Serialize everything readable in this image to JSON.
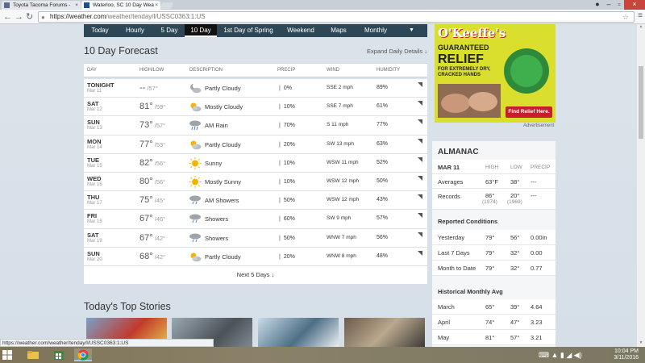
{
  "browser": {
    "tabs": [
      {
        "title": "Toyota Tacoma Forums -",
        "active": false
      },
      {
        "title": "Waterloo, SC 10 Day Wea",
        "active": true
      }
    ],
    "url_host": "https://weather.com",
    "url_path": "/weather/tenday/l/USSC0363:1:US",
    "status_url": "https://weather.com/weather/tenday/l/USSC0363:1:US"
  },
  "subnav": [
    "Today",
    "Hourly",
    "5 Day",
    "10 Day",
    "1st Day of Spring",
    "Weekend",
    "Maps",
    "Monthly"
  ],
  "forecast": {
    "title": "10 Day Forecast",
    "expand_label": "Expand Daily Details ↓",
    "headers": [
      "DAY",
      "HIGH/LOW",
      "DESCRIPTION",
      "PRECIP",
      "WIND",
      "HUMIDITY"
    ],
    "rows": [
      {
        "day": "TONIGHT",
        "date": "Mar 11",
        "hi": "--",
        "lo": "57°",
        "icon": "partly-cloudy-night-icon",
        "desc": "Partly Cloudy",
        "precip": "0%",
        "wind": "SSE 2 mph",
        "hum": "89%"
      },
      {
        "day": "SAT",
        "date": "Mar 12",
        "hi": "81°",
        "lo": "59°",
        "icon": "partly-sunny-icon",
        "desc": "Mostly Cloudy",
        "precip": "10%",
        "wind": "SSE 7 mph",
        "hum": "61%"
      },
      {
        "day": "SUN",
        "date": "Mar 13",
        "hi": "73°",
        "lo": "57°",
        "icon": "rain-icon",
        "desc": "AM Rain",
        "precip": "70%",
        "wind": "S 11 mph",
        "hum": "77%"
      },
      {
        "day": "MON",
        "date": "Mar 14",
        "hi": "77°",
        "lo": "53°",
        "icon": "partly-sunny-icon",
        "desc": "Partly Cloudy",
        "precip": "20%",
        "wind": "SW 13 mph",
        "hum": "63%"
      },
      {
        "day": "TUE",
        "date": "Mar 15",
        "hi": "82°",
        "lo": "56°",
        "icon": "sun-icon",
        "desc": "Sunny",
        "precip": "10%",
        "wind": "WSW 11 mph",
        "hum": "52%"
      },
      {
        "day": "WED",
        "date": "Mar 16",
        "hi": "80°",
        "lo": "56°",
        "icon": "sun-icon",
        "desc": "Mostly Sunny",
        "precip": "10%",
        "wind": "WSW 12 mph",
        "hum": "50%"
      },
      {
        "day": "THU",
        "date": "Mar 17",
        "hi": "75°",
        "lo": "45°",
        "icon": "showers-icon",
        "desc": "AM Showers",
        "precip": "50%",
        "wind": "WSW 12 mph",
        "hum": "43%"
      },
      {
        "day": "FRI",
        "date": "Mar 18",
        "hi": "67°",
        "lo": "46°",
        "icon": "showers-icon",
        "desc": "Showers",
        "precip": "60%",
        "wind": "SW 9 mph",
        "hum": "57%"
      },
      {
        "day": "SAT",
        "date": "Mar 19",
        "hi": "67°",
        "lo": "42°",
        "icon": "showers-icon",
        "desc": "Showers",
        "precip": "50%",
        "wind": "WNW 7 mph",
        "hum": "56%"
      },
      {
        "day": "SUN",
        "date": "Mar 20",
        "hi": "68°",
        "lo": "42°",
        "icon": "partly-sunny-icon",
        "desc": "Partly Cloudy",
        "precip": "20%",
        "wind": "WNW 8 mph",
        "hum": "48%"
      }
    ],
    "next_label": "Next 5 Days ↓"
  },
  "stories": {
    "title": "Today's Top Stories"
  },
  "ad": {
    "brand": "O'Keeffe's",
    "line1": "GUARANTEED",
    "line2": "RELIEF",
    "line3": "FOR EXTREMELY DRY, CRACKED HANDS",
    "cta": "Find Relief Here.",
    "label": "Advertisement"
  },
  "almanac": {
    "title": "ALMANAC",
    "head": {
      "label": "MAR 11",
      "c1": "HIGH",
      "c2": "LOW",
      "c3": "PRECIP"
    },
    "averages": {
      "label": "Averages",
      "hi": "63°F",
      "lo": "38°",
      "precip": "---"
    },
    "records": {
      "label": "Records",
      "hi": "86°",
      "hi_year": "(1974)",
      "lo": "20°",
      "lo_year": "(1969)",
      "precip": "---"
    },
    "reported_title": "Reported Conditions",
    "reported": [
      {
        "label": "Yesterday",
        "hi": "79°",
        "lo": "56°",
        "precip": "0.00in"
      },
      {
        "label": "Last 7 Days",
        "hi": "79°",
        "lo": "32°",
        "precip": "0.00"
      },
      {
        "label": "Month to Date",
        "hi": "79°",
        "lo": "32°",
        "precip": "0.77"
      }
    ],
    "monthly_title": "Historical Monthly Avg",
    "monthly": [
      {
        "label": "March",
        "hi": "65°",
        "lo": "39°",
        "precip": "4.64"
      },
      {
        "label": "April",
        "hi": "74°",
        "lo": "47°",
        "precip": "3.23"
      },
      {
        "label": "May",
        "hi": "81°",
        "lo": "57°",
        "precip": "3.21"
      }
    ]
  },
  "taskbar": {
    "time": "10:04 PM",
    "date": "3/11/2016"
  }
}
